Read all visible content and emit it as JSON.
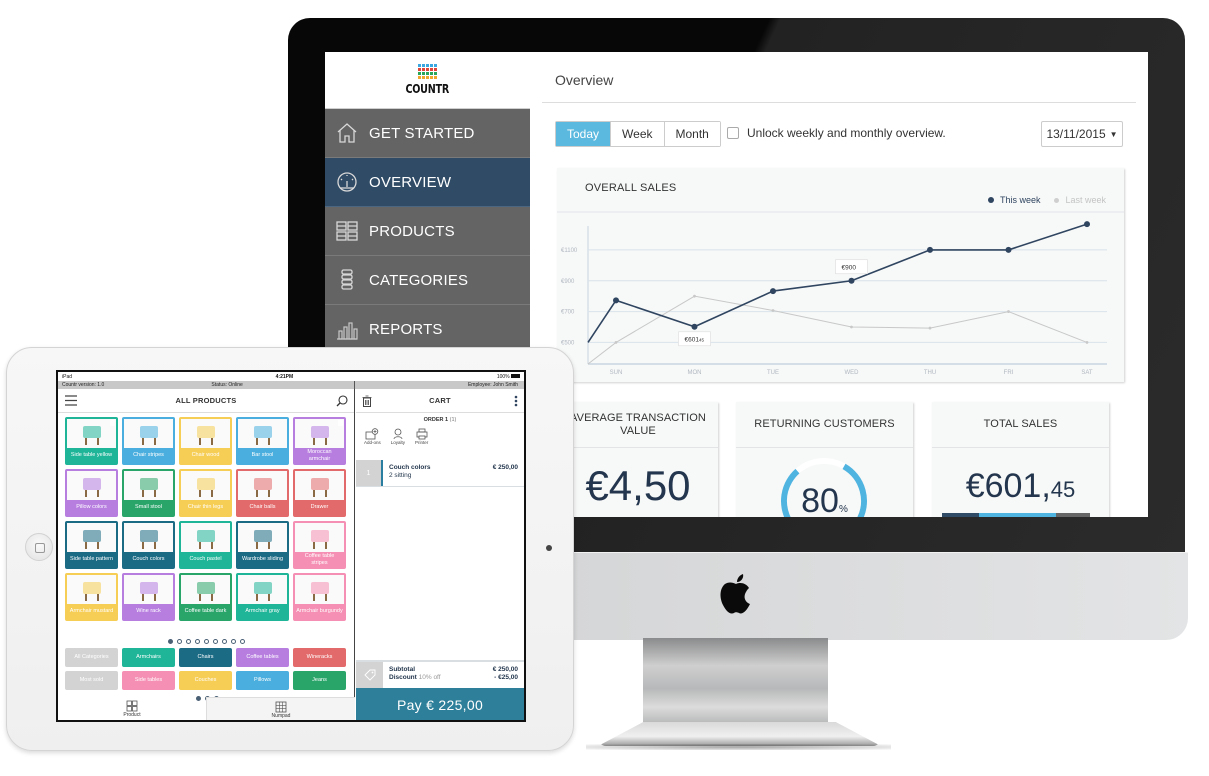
{
  "desktop": {
    "brand": {
      "name": "COUNTR",
      "logo_colors": [
        "#3aa7e0",
        "#e0453b",
        "#2aa65a",
        "#f0a52b"
      ]
    },
    "sidebar": {
      "items": [
        {
          "label": "GET STARTED",
          "icon": "home-icon",
          "active": false
        },
        {
          "label": "OVERVIEW",
          "icon": "dashboard-gauge-icon",
          "active": true
        },
        {
          "label": "PRODUCTS",
          "icon": "grid-icon",
          "active": false
        },
        {
          "label": "CATEGORIES",
          "icon": "stack-icon",
          "active": false
        },
        {
          "label": "REPORTS",
          "icon": "bar-chart-icon",
          "active": false
        }
      ]
    },
    "page_title": "Overview",
    "period_tabs": [
      {
        "label": "Today",
        "active": true
      },
      {
        "label": "Week",
        "active": false
      },
      {
        "label": "Month",
        "active": false
      }
    ],
    "unlock_checkbox": {
      "label": "Unlock weekly and monthly overview.",
      "checked": false
    },
    "date_select": {
      "value": "13/11/2015"
    },
    "stats": {
      "avg_transaction": {
        "title": "AVERAGE TRANSACTION VALUE",
        "value": "€4,50"
      },
      "returning_customers": {
        "title": "RETURNING CUSTOMERS",
        "value": "80",
        "unit": "%",
        "fraction": 0.8
      },
      "total_sales": {
        "title": "TOTAL SALES",
        "value_main": "€601,",
        "value_cents": "45",
        "segments": [
          {
            "color": "#2f4b66",
            "share": 0.25
          },
          {
            "color": "#4fb4e0",
            "share": 0.52
          },
          {
            "color": "#666666",
            "share": 0.23
          }
        ]
      }
    },
    "colors": {
      "accent": "#5bb8de",
      "navy": "#2f4b66",
      "sidebar": "#646464"
    }
  },
  "chart_data": {
    "type": "line",
    "title": "OVERALL SALES",
    "categories": [
      "SUN",
      "MON",
      "TUE",
      "WED",
      "THU",
      "FRI",
      "SAT"
    ],
    "yticks": [
      "€500",
      "€700",
      "€900",
      "€1100"
    ],
    "ytick_values": [
      500,
      700,
      900,
      1100
    ],
    "ylim": [
      360,
      1320
    ],
    "grid": true,
    "legend_position": "top-right",
    "series": [
      {
        "name": "This week",
        "color": "#2f4560",
        "start_value": 500,
        "values": [
          773,
          601.45,
          833,
          900,
          1100,
          1100,
          1267
        ]
      },
      {
        "name": "Last week",
        "color": "#c8c8c8",
        "start_value": 360,
        "values": [
          500,
          800,
          707,
          600,
          593,
          700,
          500
        ]
      }
    ],
    "annotations": [
      {
        "series": "This week",
        "category": "MON",
        "text": "€601",
        "small": "45"
      },
      {
        "series": "This week",
        "category": "WED",
        "text": "€900",
        "small": ""
      }
    ]
  },
  "tablet": {
    "status_bar": {
      "device": "iPad",
      "time": "4:21PM",
      "battery": "100%"
    },
    "info_bar": {
      "version": "Countr version: 1.0",
      "status": "Status: Online",
      "employee": "Employee: John Smith"
    },
    "products_header": "ALL PRODUCTS",
    "products": [
      {
        "name": "Side table yellow",
        "color": "#1fb598",
        "flag": true
      },
      {
        "name": "Chair stripes",
        "color": "#4aaede"
      },
      {
        "name": "Chair wood",
        "color": "#f6cd55"
      },
      {
        "name": "Bar stool",
        "color": "#4aaede"
      },
      {
        "name": "Moroccan armchair",
        "color": "#b77ee0",
        "flag": true
      },
      {
        "name": "Pillow colors",
        "color": "#b77ee0"
      },
      {
        "name": "Small stool",
        "color": "#2aa56a"
      },
      {
        "name": "Chair thin legs",
        "color": "#f6cd55"
      },
      {
        "name": "Chair balls",
        "color": "#e36a6a"
      },
      {
        "name": "Drawer",
        "color": "#e36a6a"
      },
      {
        "name": "Side table pattern",
        "color": "#1c6b85"
      },
      {
        "name": "Couch colors",
        "color": "#1c6b85"
      },
      {
        "name": "Couch pastel",
        "color": "#1fb598"
      },
      {
        "name": "Wardrobe sliding",
        "color": "#1c6b85"
      },
      {
        "name": "Coffee table stripes",
        "color": "#f58fb3"
      },
      {
        "name": "Armchair mustard",
        "color": "#f6cd55"
      },
      {
        "name": "Wine rack",
        "color": "#b77ee0"
      },
      {
        "name": "Coffee table dark",
        "color": "#2aa56a"
      },
      {
        "name": "Armchair gray",
        "color": "#1fb598"
      },
      {
        "name": "Armchair burgundy",
        "color": "#f58fb3"
      }
    ],
    "product_pages": {
      "count": 9,
      "current": 0
    },
    "categories": [
      {
        "name": "All Categories",
        "color": "#d3d3d3"
      },
      {
        "name": "Armchairs",
        "color": "#1fb598"
      },
      {
        "name": "Chairs",
        "color": "#1c6b85"
      },
      {
        "name": "Coffee tables",
        "color": "#b77ee0"
      },
      {
        "name": "Wineracks",
        "color": "#e36a6a"
      },
      {
        "name": "Most sold",
        "color": "#d3d3d3"
      },
      {
        "name": "Side tables",
        "color": "#f58fb3"
      },
      {
        "name": "Couches",
        "color": "#f6cd55"
      },
      {
        "name": "Pillows",
        "color": "#4aaede"
      },
      {
        "name": "Jeans",
        "color": "#2aa56a"
      }
    ],
    "category_pages": {
      "count": 3,
      "current": 0
    },
    "bottom_tabs": [
      {
        "label": "Product",
        "icon": "grid-icon"
      },
      {
        "label": "Numpad",
        "icon": "numpad-icon"
      }
    ],
    "cart": {
      "header": "CART",
      "order_title": "ORDER 1",
      "order_count": "(1)",
      "actions": [
        {
          "label": "Add-ons",
          "icon": "add-ons-icon"
        },
        {
          "label": "Loyalty",
          "icon": "loyalty-icon"
        },
        {
          "label": "Printer",
          "icon": "printer-icon"
        }
      ],
      "lines": [
        {
          "qty": "1",
          "name": "Couch colors",
          "variant": "2 sitting",
          "price": "€ 250,00"
        }
      ],
      "subtotal_label": "Subtotal",
      "subtotal": "€ 250,00",
      "discount_label": "Discount",
      "discount_note": "10% off",
      "discount": "- €25,00",
      "pay_label": "Pay € 225,00"
    }
  }
}
